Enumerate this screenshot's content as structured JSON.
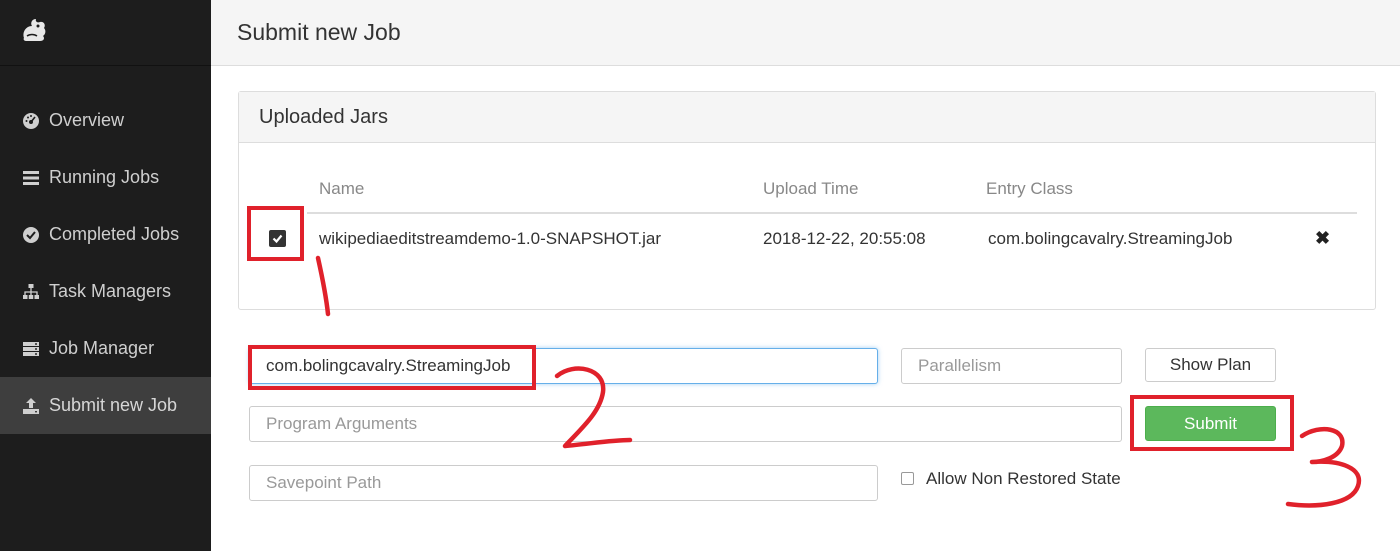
{
  "header": {
    "title": "Submit new Job"
  },
  "sidebar": {
    "items": [
      {
        "label": "Overview",
        "icon": "dashboard-icon",
        "active": false
      },
      {
        "label": "Running Jobs",
        "icon": "list-icon",
        "active": false
      },
      {
        "label": "Completed Jobs",
        "icon": "check-circle-icon",
        "active": false
      },
      {
        "label": "Task Managers",
        "icon": "sitemap-icon",
        "active": false
      },
      {
        "label": "Job Manager",
        "icon": "server-icon",
        "active": false
      },
      {
        "label": "Submit new Job",
        "icon": "upload-icon",
        "active": true
      }
    ]
  },
  "jars": {
    "title": "Uploaded Jars",
    "columns": [
      "Name",
      "Upload Time",
      "Entry Class"
    ],
    "rows": [
      {
        "name": "wikipediaeditstreamdemo-1.0-SNAPSHOT.jar",
        "upload_time": "2018-12-22, 20:55:08",
        "entry_class": "com.bolingcavalry.StreamingJob",
        "checked": true
      }
    ]
  },
  "form": {
    "entry_class_value": "com.bolingcavalry.StreamingJob",
    "parallelism_placeholder": "Parallelism",
    "show_plan_label": "Show Plan",
    "program_args_placeholder": "Program Arguments",
    "submit_label": "Submit",
    "savepoint_placeholder": "Savepoint Path",
    "allow_non_restored_label": "Allow Non Restored State"
  },
  "colors": {
    "sidebar_bg": "#1d1d1d",
    "submit_green": "#5cb85c",
    "annotation_red": "#e0212b"
  }
}
